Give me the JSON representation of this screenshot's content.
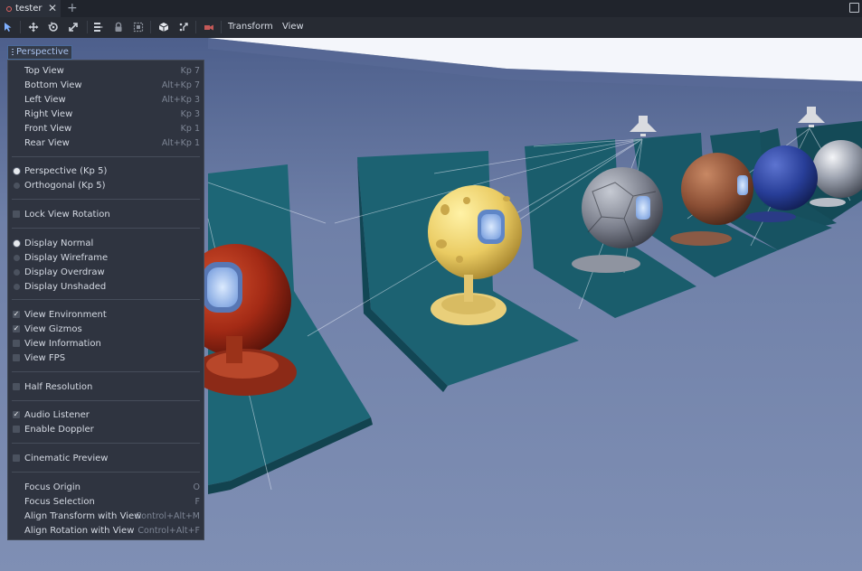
{
  "tab": {
    "title": "tester",
    "close_glyph": "✕",
    "add_glyph": "+"
  },
  "toolbar": {
    "icons": [
      "select-arrow-icon",
      "move-icon",
      "rotate-icon",
      "scale-icon",
      "list-select-icon",
      "lock-icon",
      "group-icon",
      "local-space-icon",
      "snap-icon",
      "camera-icon"
    ],
    "menus": {
      "transform": "Transform",
      "view": "View"
    }
  },
  "viewport": {
    "perspective_button": "Perspective"
  },
  "menu": {
    "top_view": {
      "label": "Top View",
      "shortcut": "Kp 7"
    },
    "bottom_view": {
      "label": "Bottom View",
      "shortcut": "Alt+Kp 7"
    },
    "left_view": {
      "label": "Left View",
      "shortcut": "Alt+Kp 3"
    },
    "right_view": {
      "label": "Right View",
      "shortcut": "Kp 3"
    },
    "front_view": {
      "label": "Front View",
      "shortcut": "Kp 1"
    },
    "rear_view": {
      "label": "Rear View",
      "shortcut": "Alt+Kp 1"
    },
    "perspective": {
      "label": "Perspective (Kp 5)",
      "selected": true
    },
    "orthogonal": {
      "label": "Orthogonal (Kp 5)",
      "selected": false
    },
    "lock_view_rotation": {
      "label": "Lock View Rotation",
      "checked": false
    },
    "display_normal": {
      "label": "Display Normal",
      "selected": true
    },
    "display_wireframe": {
      "label": "Display Wireframe",
      "selected": false
    },
    "display_overdraw": {
      "label": "Display Overdraw",
      "selected": false
    },
    "display_unshaded": {
      "label": "Display Unshaded",
      "selected": false
    },
    "view_environment": {
      "label": "View Environment",
      "checked": true
    },
    "view_gizmos": {
      "label": "View Gizmos",
      "checked": true
    },
    "view_information": {
      "label": "View Information",
      "checked": false
    },
    "view_fps": {
      "label": "View FPS",
      "checked": false
    },
    "half_resolution": {
      "label": "Half Resolution",
      "checked": false
    },
    "audio_listener": {
      "label": "Audio Listener",
      "checked": true
    },
    "enable_doppler": {
      "label": "Enable Doppler",
      "checked": false
    },
    "cinematic_preview": {
      "label": "Cinematic Preview",
      "checked": false
    },
    "focus_origin": {
      "label": "Focus Origin",
      "shortcut": "O"
    },
    "focus_selection": {
      "label": "Focus Selection",
      "shortcut": "F"
    },
    "align_transform": {
      "label": "Align Transform with View",
      "shortcut": "Control+Alt+M"
    },
    "align_rotation": {
      "label": "Align Rotation with View",
      "shortcut": "Control+Alt+F"
    }
  },
  "colors": {
    "accent": "#a9c2ee",
    "menu_bg": "#2f3440",
    "viewport_floor": "#7181a8"
  }
}
